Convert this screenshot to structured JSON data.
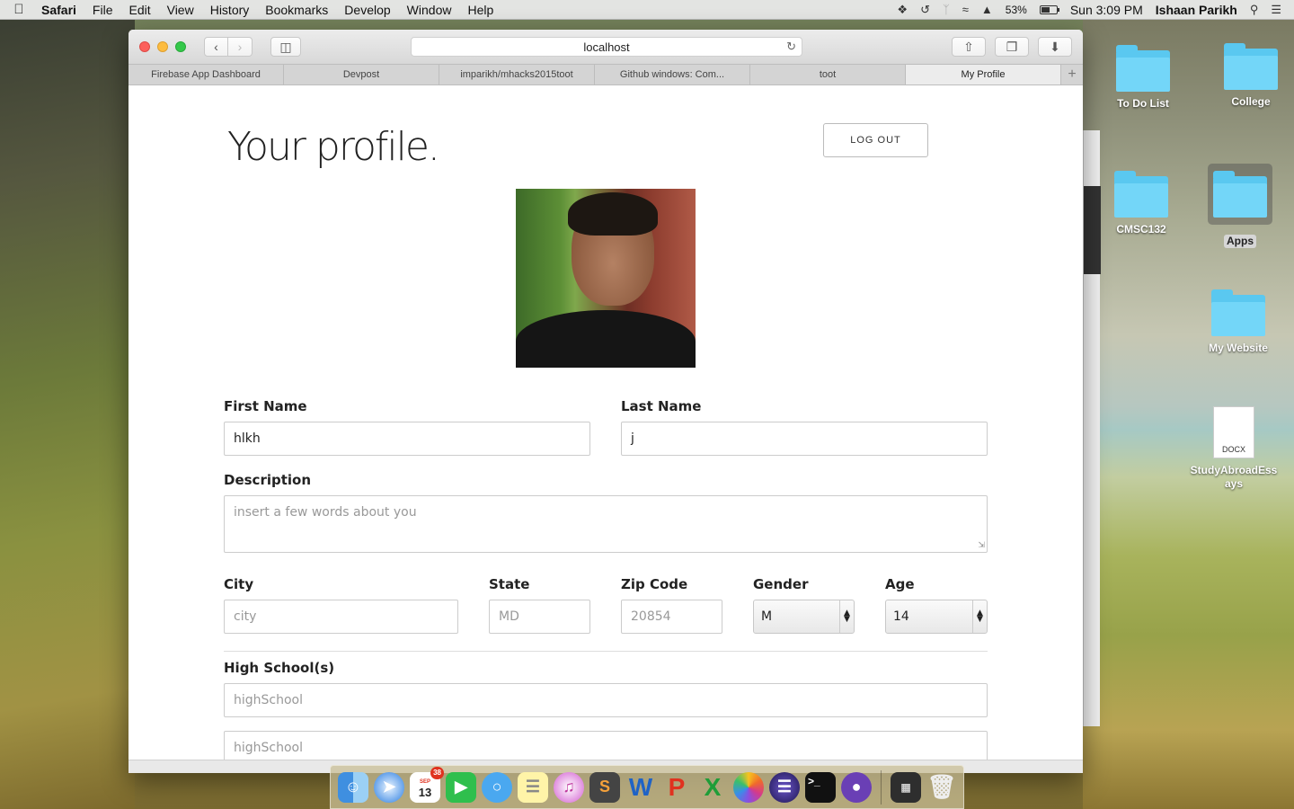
{
  "menubar": {
    "app_name": "Safari",
    "menus": [
      "File",
      "Edit",
      "View",
      "History",
      "Bookmarks",
      "Develop",
      "Window",
      "Help"
    ],
    "battery": "53%",
    "clock": "Sun 3:09 PM",
    "user": "Ishaan Parikh"
  },
  "browser": {
    "url": "localhost",
    "tabs": [
      {
        "label": "Firebase App Dashboard"
      },
      {
        "label": "Devpost"
      },
      {
        "label": "imparikh/mhacks2015toot"
      },
      {
        "label": "Github windows: Com..."
      },
      {
        "label": "toot"
      },
      {
        "label": "My Profile"
      }
    ]
  },
  "page": {
    "title": "Your profile.",
    "logout_label": "LOG OUT",
    "first_name": {
      "label": "First Name",
      "value": "hlkh"
    },
    "last_name": {
      "label": "Last Name",
      "value": "j"
    },
    "description": {
      "label": "Description",
      "placeholder": "insert a few words about you"
    },
    "city": {
      "label": "City",
      "placeholder": "city"
    },
    "state": {
      "label": "State",
      "placeholder": "MD"
    },
    "zip": {
      "label": "Zip Code",
      "placeholder": "20854"
    },
    "gender": {
      "label": "Gender",
      "value": "M"
    },
    "age": {
      "label": "Age",
      "value": "14"
    },
    "high_school": {
      "label": "High School(s)",
      "placeholder_1": "highSchool",
      "placeholder_2": "highSchool"
    }
  },
  "desktop": {
    "icons": [
      {
        "label": "To Do List"
      },
      {
        "label": "College"
      },
      {
        "label": "CMSC132"
      },
      {
        "label": "Apps"
      },
      {
        "label": "My Website"
      },
      {
        "label": "StudyAbroadEssays",
        "type": "DOCX"
      }
    ]
  },
  "dock": {
    "calendar_month": "SEP",
    "calendar_day": "13",
    "calendar_badge": "38"
  },
  "colors": {
    "folder": "#5ac8f0",
    "close": "#fc605c",
    "minimize": "#fdbc40",
    "maximize": "#34c84a"
  }
}
